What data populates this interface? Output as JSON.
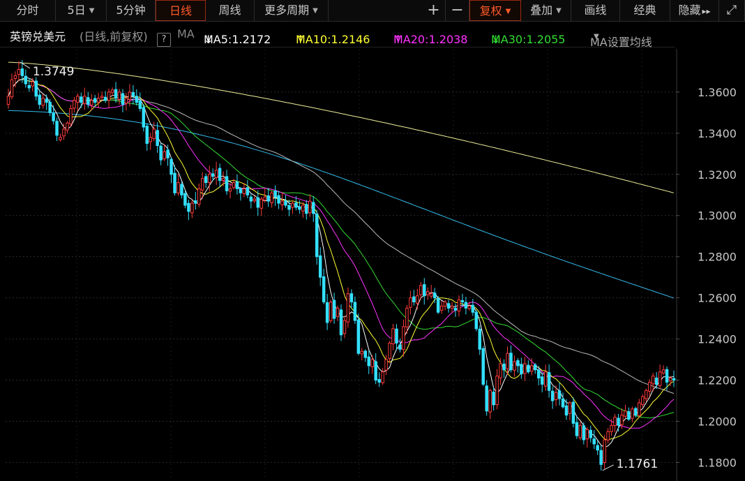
{
  "toolbar": {
    "fenshi": "分时",
    "five_day": "5日",
    "five_min": "5分钟",
    "daily": "日线",
    "weekly": "周线",
    "more_periods": "更多周期",
    "zoom_in": "+",
    "zoom_out": "−",
    "fuquan": "复权",
    "overlay": "叠加",
    "draw": "画线",
    "classic": "经典",
    "hide": "隐藏",
    "hide_arrows": "▸▸",
    "expand": "⤢"
  },
  "legend": {
    "name": "英镑兑美元",
    "mode": "(日线,前复权)",
    "help": "?",
    "ma_tag": "MA",
    "ma5": "MA5:1.2172",
    "ma5_arrow": "↓",
    "ma10": "MA10:1.2146",
    "ma10_arrow": "↑",
    "ma20": "MA20:1.2038",
    "ma20_arrow": "↑",
    "ma30": "MA30:1.2055",
    "ma30_arrow": "↓",
    "settings": "MA设置均线"
  },
  "colors": {
    "up": "#ff3b3b",
    "down": "#33e0ff",
    "ma5": "#ffffff",
    "ma10": "#ffff33",
    "ma20": "#ff33ff",
    "ma30": "#33dd33",
    "ma60": "#bbbbbb",
    "ma120": "#33bbee",
    "ma250": "#eeee99",
    "active": "#ff5a2a"
  },
  "chart_data": {
    "type": "candlestick",
    "instrument": "英镑兑美元",
    "period": "日线",
    "ylim": [
      1.172,
      1.381
    ],
    "y_ticks": [
      1.18,
      1.2,
      1.22,
      1.24,
      1.26,
      1.28,
      1.3,
      1.32,
      1.34,
      1.36
    ],
    "y_tick_labels": [
      "1.1800",
      "1.2000",
      "1.2200",
      "1.2400",
      "1.2600",
      "1.2800",
      "1.3000",
      "1.3200",
      "1.3400",
      "1.3600"
    ],
    "max_label": "1.3749",
    "min_label": "1.1761",
    "grid": true,
    "closes": [
      1.358,
      1.366,
      1.368,
      1.371,
      1.368,
      1.364,
      1.362,
      1.365,
      1.358,
      1.354,
      1.357,
      1.355,
      1.35,
      1.346,
      1.339,
      1.338,
      1.342,
      1.345,
      1.352,
      1.356,
      1.358,
      1.355,
      1.358,
      1.354,
      1.356,
      1.355,
      1.357,
      1.358,
      1.356,
      1.36,
      1.361,
      1.357,
      1.36,
      1.354,
      1.357,
      1.36,
      1.358,
      1.355,
      1.352,
      1.343,
      1.335,
      1.338,
      1.342,
      1.334,
      1.327,
      1.331,
      1.328,
      1.32,
      1.311,
      1.316,
      1.31,
      1.305,
      1.302,
      1.306,
      1.306,
      1.313,
      1.318,
      1.316,
      1.32,
      1.319,
      1.322,
      1.317,
      1.318,
      1.312,
      1.313,
      1.316,
      1.313,
      1.311,
      1.313,
      1.31,
      1.307,
      1.308,
      1.304,
      1.308,
      1.309,
      1.307,
      1.311,
      1.309,
      1.306,
      1.307,
      1.305,
      1.303,
      1.306,
      1.304,
      1.303,
      1.305,
      1.301,
      1.307,
      1.301,
      1.28,
      1.27,
      1.258,
      1.248,
      1.258,
      1.25,
      1.255,
      1.242,
      1.249,
      1.262,
      1.258,
      1.249,
      1.233,
      1.234,
      1.231,
      1.227,
      1.23,
      1.22,
      1.219,
      1.224,
      1.23,
      1.238,
      1.245,
      1.238,
      1.235,
      1.246,
      1.255,
      1.26,
      1.258,
      1.261,
      1.266,
      1.261,
      1.263,
      1.262,
      1.26,
      1.253,
      1.256,
      1.258,
      1.255,
      1.256,
      1.254,
      1.259,
      1.258,
      1.255,
      1.256,
      1.253,
      1.245,
      1.235,
      1.218,
      1.205,
      1.215,
      1.208,
      1.222,
      1.228,
      1.225,
      1.233,
      1.225,
      1.229,
      1.227,
      1.223,
      1.228,
      1.224,
      1.227,
      1.225,
      1.221,
      1.218,
      1.224,
      1.215,
      1.21,
      1.214,
      1.211,
      1.207,
      1.203,
      1.209,
      1.199,
      1.193,
      1.198,
      1.191,
      1.196,
      1.192,
      1.189,
      1.186,
      1.179,
      1.191,
      1.195,
      1.198,
      1.202,
      1.198,
      1.203,
      1.205,
      1.201,
      1.206,
      1.203,
      1.209,
      1.212,
      1.215,
      1.219,
      1.222,
      1.218,
      1.224,
      1.225,
      1.219,
      1.221,
      1.22
    ]
  }
}
